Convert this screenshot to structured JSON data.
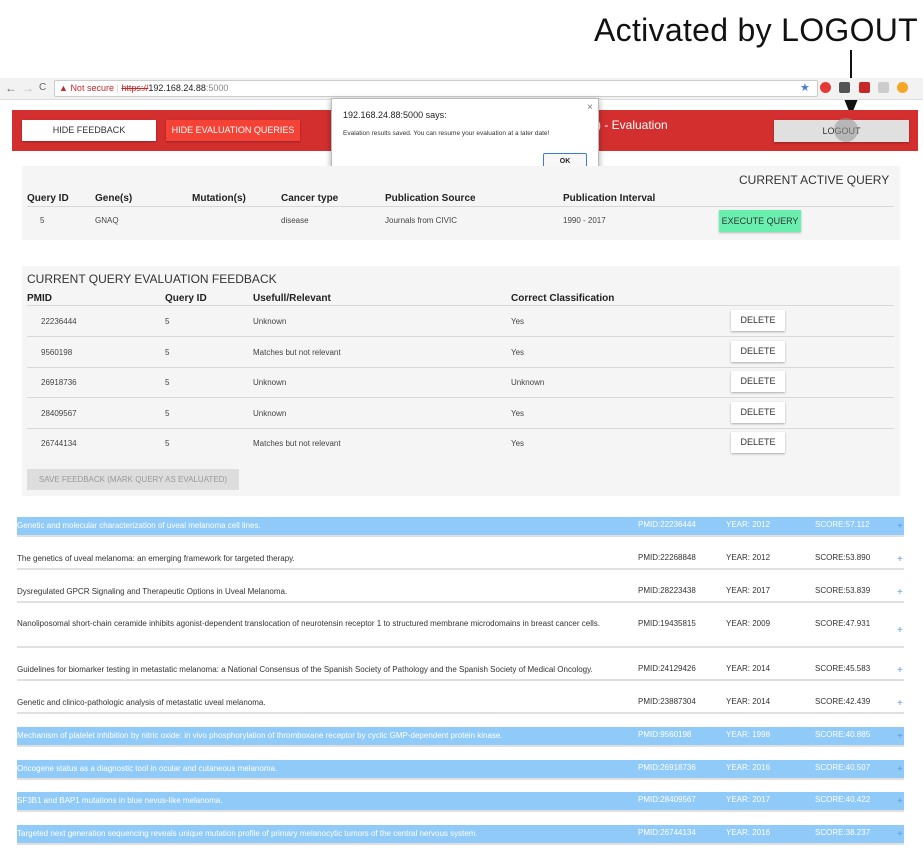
{
  "annotation": {
    "label": "Activated by LOGOUT"
  },
  "browser": {
    "not_secure": "Not secure",
    "url_proto": "https://",
    "url_host": "192.168.24.88",
    "url_port": ":5000"
  },
  "header": {
    "hide_feedback": "HIDE FEEDBACK",
    "hide_eval_queries": "HIDE EVALUATION QUERIES",
    "title": ") - Evaluation",
    "logout": "LOGOUT"
  },
  "dialog": {
    "title": "192.168.24.88:5000 says:",
    "message": "Evalation results saved. You can resume your evaluation at a later date!",
    "ok": "OK",
    "close": "×"
  },
  "active_query": {
    "heading": "CURRENT ACTIVE QUERY",
    "columns": [
      "Query ID",
      "Gene(s)",
      "Mutation(s)",
      "Cancer type",
      "Publication Source",
      "Publication Interval"
    ],
    "row": {
      "query_id": "5",
      "genes": "GNAQ",
      "mutations": "",
      "cancer_type": "disease",
      "source": "Journals from CIVIC",
      "interval": "1990 - 2017"
    },
    "execute": "EXECUTE QUERY"
  },
  "feedback": {
    "heading": "CURRENT QUERY EVALUATION FEEDBACK",
    "columns": [
      "PMID",
      "Query ID",
      "Usefull/Relevant",
      "Correct Classification"
    ],
    "rows": [
      {
        "pmid": "22236444",
        "query_id": "5",
        "relevant": "Unknown",
        "classification": "Yes",
        "delete": "DELETE"
      },
      {
        "pmid": "9560198",
        "query_id": "5",
        "relevant": "Matches but not relevant",
        "classification": "Yes",
        "delete": "DELETE"
      },
      {
        "pmid": "26918736",
        "query_id": "5",
        "relevant": "Unknown",
        "classification": "Unknown",
        "delete": "DELETE"
      },
      {
        "pmid": "28409567",
        "query_id": "5",
        "relevant": "Unknown",
        "classification": "Yes",
        "delete": "DELETE"
      },
      {
        "pmid": "26744134",
        "query_id": "5",
        "relevant": "Matches but not relevant",
        "classification": "Yes",
        "delete": "DELETE"
      }
    ],
    "save": "SAVE FEEDBACK (MARK QUERY AS EVALUATED)"
  },
  "results": [
    {
      "title": "Genetic and molecular characterization of uveal melanoma cell lines.",
      "pmid": "PMID:22236444",
      "year": "YEAR: 2012",
      "score": "SCORE:57.112",
      "highlighted": true
    },
    {
      "title": "The genetics of uveal melanoma: an emerging framework for targeted therapy.",
      "pmid": "PMID:22268848",
      "year": "YEAR: 2012",
      "score": "SCORE:53.890",
      "highlighted": false
    },
    {
      "title": "Dysregulated GPCR Signaling and Therapeutic Options in Uveal Melanoma.",
      "pmid": "PMID:28223438",
      "year": "YEAR: 2017",
      "score": "SCORE:53.839",
      "highlighted": false
    },
    {
      "title": "Nanoliposomal short-chain ceramide inhibits agonist-dependent translocation of neurotensin receptor 1 to structured membrane microdomains in breast cancer cells.",
      "pmid": "PMID:19435815",
      "year": "YEAR: 2009",
      "score": "SCORE:47.931",
      "highlighted": false
    },
    {
      "title": "Guidelines for biomarker testing in metastatic melanoma: a National Consensus of the Spanish Society of Pathology and the Spanish Society of Medical Oncology.",
      "pmid": "PMID:24129426",
      "year": "YEAR: 2014",
      "score": "SCORE:45.583",
      "highlighted": false
    },
    {
      "title": "Genetic and clinico-pathologic analysis of metastatic uveal melanoma.",
      "pmid": "PMID:23887304",
      "year": "YEAR: 2014",
      "score": "SCORE:42.439",
      "highlighted": false
    },
    {
      "title": "Mechanism of platelet inhibition by nitric oxide: in vivo phosphorylation of thromboxane receptor by cyclic GMP-dependent protein kinase.",
      "pmid": "PMID:9560198",
      "year": "YEAR: 1998",
      "score": "SCORE:40.885",
      "highlighted": true
    },
    {
      "title": "Oncogene status as a diagnostic tool in ocular and cutaneous melanoma.",
      "pmid": "PMID:26918736",
      "year": "YEAR: 2016",
      "score": "SCORE:40.507",
      "highlighted": true
    },
    {
      "title": "SF3B1 and BAP1 mutations in blue nevus-like melanoma.",
      "pmid": "PMID:28409567",
      "year": "YEAR: 2017",
      "score": "SCORE:40.422",
      "highlighted": true
    },
    {
      "title": "Targeted next generation sequencing reveals unique mutation profile of primary melanocytic tumors of the central nervous system.",
      "pmid": "PMID:26744134",
      "year": "YEAR: 2016",
      "score": "SCORE:38.237",
      "highlighted": true
    }
  ],
  "icons": {
    "plus": "+",
    "star": "★",
    "back": "←",
    "forward": "→",
    "reload": "C",
    "warning": "▲"
  },
  "colors": {
    "header_red": "#d32f2f",
    "accent_red": "#f44336",
    "execute_green": "#69f0ae",
    "highlight_blue": "#90caf9"
  }
}
